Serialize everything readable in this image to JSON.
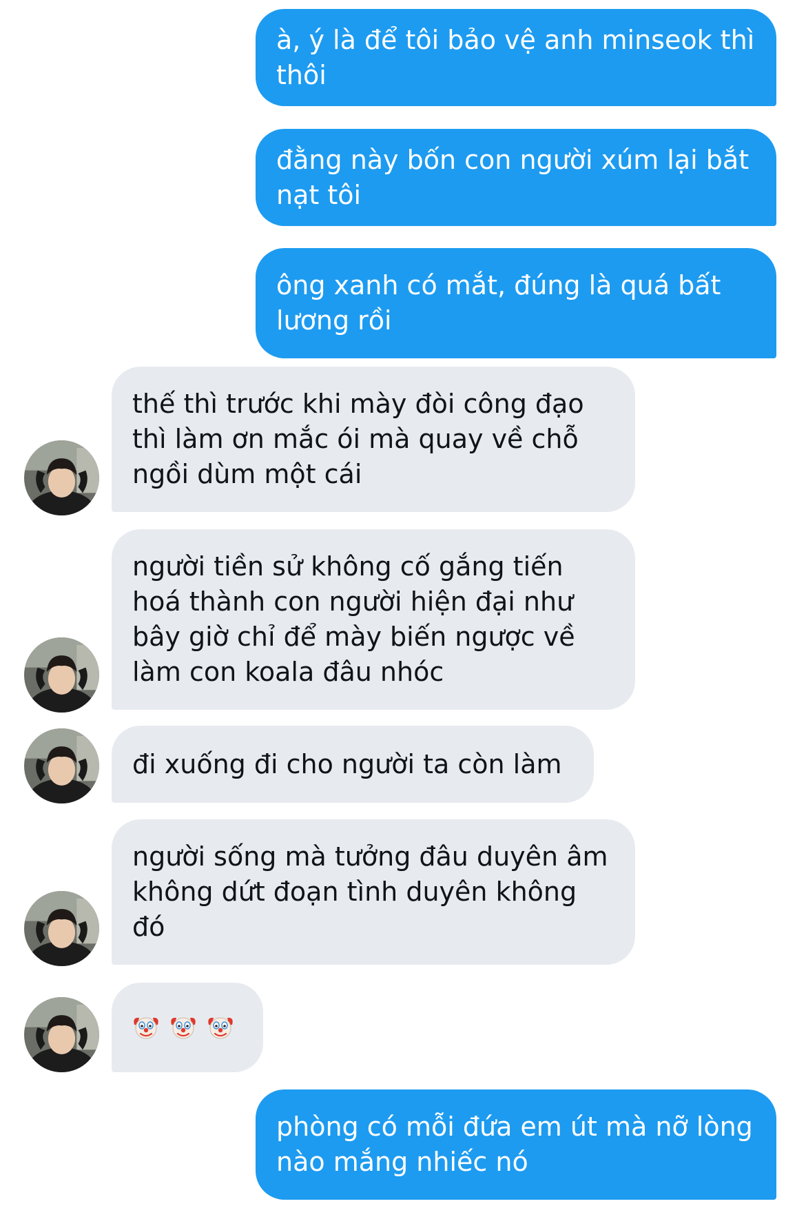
{
  "conversation": {
    "messages": [
      {
        "direction": "sent",
        "text": "à, ý là để tôi bảo vệ anh minseok thì thôi"
      },
      {
        "direction": "sent",
        "text": "đằng này bốn con người xúm lại bắt nạt tôi"
      },
      {
        "direction": "sent",
        "text": "ông xanh có mắt, đúng là quá bất lương rồi"
      },
      {
        "direction": "received",
        "text": "thế thì trước khi mày đòi công đạo thì làm ơn mắc ói mà quay về chỗ ngồi dùm một cái"
      },
      {
        "direction": "received",
        "text": "người tiền sử không cố gắng tiến hoá thành con người hiện đại như bây giờ chỉ để mày biến ngược về làm con koala đâu nhóc"
      },
      {
        "direction": "received",
        "text": "đi xuống đi cho người ta còn làm"
      },
      {
        "direction": "received",
        "text": "người sống mà tưởng đâu duyên âm không dứt đoạn tình duyên không đó"
      },
      {
        "direction": "received",
        "emoji": [
          "clown-face",
          "clown-face",
          "clown-face"
        ]
      },
      {
        "direction": "sent",
        "text": "phòng có mỗi đứa em út mà nỡ lòng nào mắng nhiếc nó"
      }
    ]
  },
  "colors": {
    "sent_bubble": "#1d9bf0",
    "sent_text": "#ffffff",
    "received_bubble": "#e7ebef",
    "received_text": "#0f1419",
    "background": "#ffffff"
  }
}
